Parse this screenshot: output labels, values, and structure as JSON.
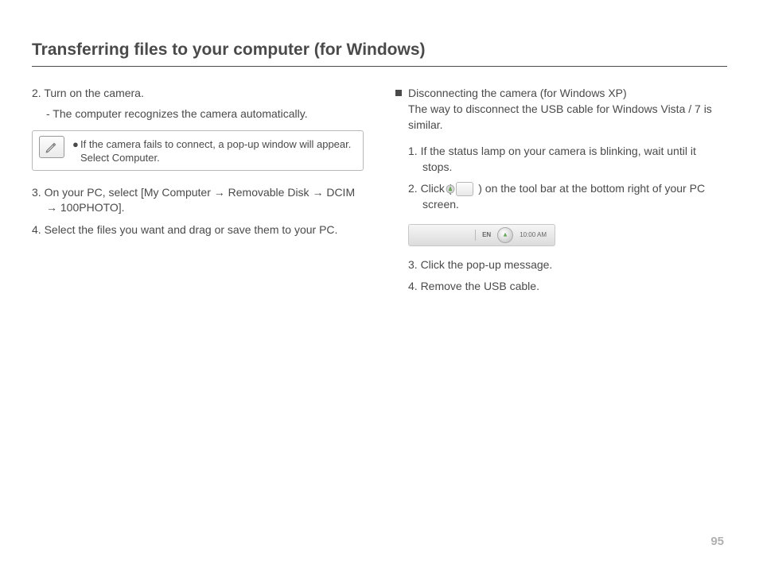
{
  "page": {
    "title": "Transferring files to your computer (for Windows)",
    "number": "95"
  },
  "left": {
    "step2": "2. Turn on the camera.",
    "step2_sub": "- The computer recognizes the camera automatically.",
    "note_line1": "If the camera fails to connect, a pop-up window will appear.",
    "note_line2": "Select Computer.",
    "step3": "3. On your PC, select [My Computer → Removable Disk → DCIM → 100PHOTO].",
    "step4": "4. Select the files you want and drag or save them to your PC."
  },
  "right": {
    "heading": "Disconnecting the camera (for Windows XP)",
    "desc": "The way to disconnect the USB cable for Windows Vista / 7 is similar.",
    "step1": "1. If the status lamp on your camera is blinking, wait until it stops.",
    "step2_a": "2. Click (",
    "step2_b": ") on the tool bar at the bottom right of your PC screen.",
    "taskbar_lang": "EN",
    "taskbar_time": "10:00 AM",
    "step3": "3. Click the pop-up message.",
    "step4": "4. Remove the USB cable."
  }
}
